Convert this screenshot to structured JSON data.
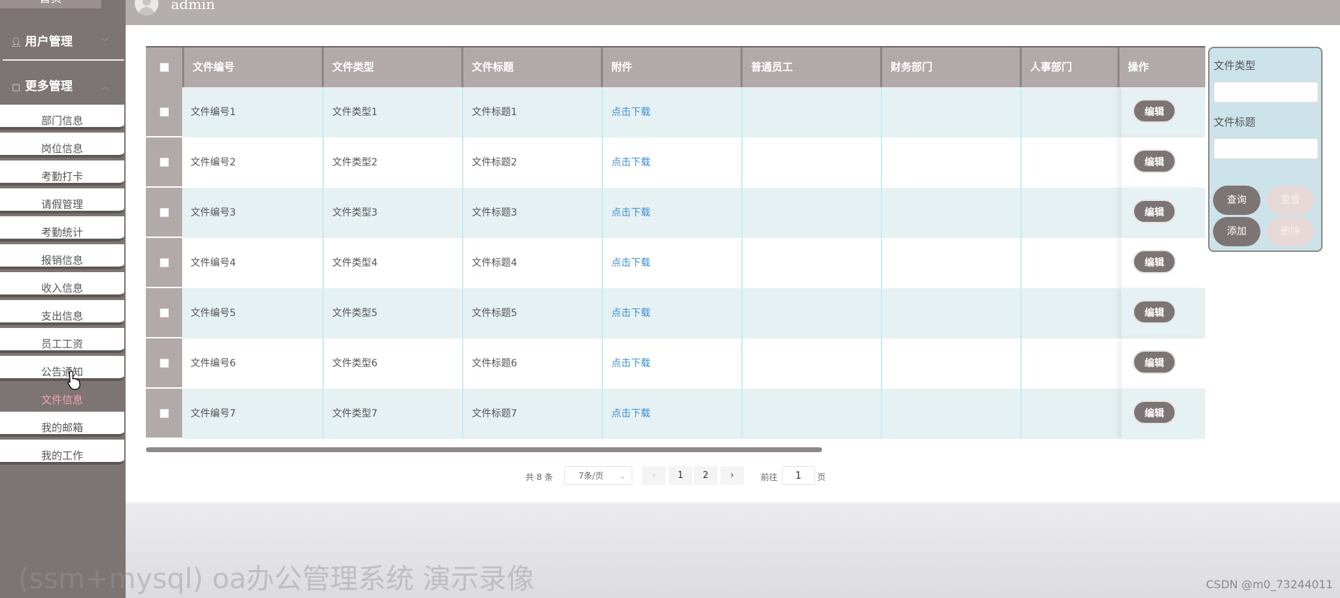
{
  "sidebar": {
    "home_label": "首页",
    "groups": [
      {
        "label": "用户管理",
        "icon": "user-icon"
      },
      {
        "label": "更多管理",
        "icon": "square-icon"
      }
    ],
    "items": [
      {
        "label": "部门信息"
      },
      {
        "label": "岗位信息"
      },
      {
        "label": "考勤打卡"
      },
      {
        "label": "请假管理"
      },
      {
        "label": "考勤统计"
      },
      {
        "label": "报销信息"
      },
      {
        "label": "收入信息"
      },
      {
        "label": "支出信息"
      },
      {
        "label": "员工工资"
      },
      {
        "label": "公告通知"
      },
      {
        "label": "文件信息",
        "active": true
      },
      {
        "label": "我的邮箱"
      },
      {
        "label": "我的工作"
      }
    ]
  },
  "topbar": {
    "username": "admin"
  },
  "table": {
    "columns": [
      "文件编号",
      "文件类型",
      "文件标题",
      "附件",
      "普通员工",
      "财务部门",
      "人事部门",
      "操作"
    ],
    "rows": [
      {
        "code": "文件编号1",
        "type": "文件类型1",
        "title": "文件标题1",
        "attachment": "点击下载",
        "staff": "",
        "finance": "",
        "hr": "",
        "action": "编辑"
      },
      {
        "code": "文件编号2",
        "type": "文件类型2",
        "title": "文件标题2",
        "attachment": "点击下载",
        "staff": "",
        "finance": "",
        "hr": "",
        "action": "编辑"
      },
      {
        "code": "文件编号3",
        "type": "文件类型3",
        "title": "文件标题3",
        "attachment": "点击下载",
        "staff": "",
        "finance": "",
        "hr": "",
        "action": "编辑"
      },
      {
        "code": "文件编号4",
        "type": "文件类型4",
        "title": "文件标题4",
        "attachment": "点击下载",
        "staff": "",
        "finance": "",
        "hr": "",
        "action": "编辑"
      },
      {
        "code": "文件编号5",
        "type": "文件类型5",
        "title": "文件标题5",
        "attachment": "点击下载",
        "staff": "",
        "finance": "",
        "hr": "",
        "action": "编辑"
      },
      {
        "code": "文件编号6",
        "type": "文件类型6",
        "title": "文件标题6",
        "attachment": "点击下载",
        "staff": "",
        "finance": "",
        "hr": "",
        "action": "编辑"
      },
      {
        "code": "文件编号7",
        "type": "文件类型7",
        "title": "文件标题7",
        "attachment": "点击下载",
        "staff": "",
        "finance": "",
        "hr": "",
        "action": "编辑"
      }
    ]
  },
  "search": {
    "type_label": "文件类型",
    "title_label": "文件标题",
    "query_label": "查询",
    "reset_label": "重置",
    "add_label": "添加",
    "delete_label": "删除"
  },
  "pagination": {
    "total": "共 8 条",
    "page_size": "7条/页",
    "prev": "‹",
    "pages": [
      "1",
      "2"
    ],
    "next": "›",
    "goto_label": "前往",
    "current_page": "1",
    "page_unit": "页"
  },
  "watermarks": {
    "video_title": "(ssm+mysql) oa办公管理系统 演示录像",
    "csdn": "CSDN @m0_73244011"
  },
  "colors": {
    "sidebar_bg": "#7d7574",
    "header_bg": "#b2a9a9",
    "row_alt": "#e6f1f3",
    "link": "#3d8fd6",
    "active_item": "#f2a4ab",
    "search_panel": "#cde3ea"
  }
}
